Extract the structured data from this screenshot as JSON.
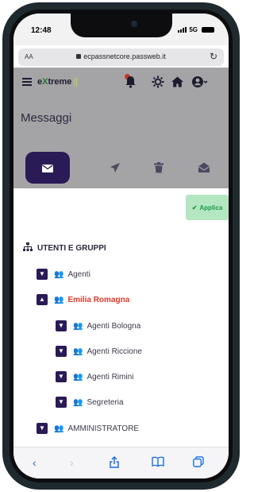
{
  "status": {
    "time": "12:48",
    "network": "5G"
  },
  "browser": {
    "text_size": "AA",
    "url": "ecpassnetcore.passweb.it",
    "reload_icon": "reload-icon"
  },
  "appbar": {
    "brand_prefix": "e",
    "brand_x": "X",
    "brand_rest": "treme",
    "brand_bar": "||",
    "icons": [
      "menu-icon",
      "bell-icon",
      "sun-icon",
      "home-icon",
      "user-icon"
    ]
  },
  "page": {
    "title": "Messaggi",
    "tabs": [
      {
        "icon": "envelope-icon",
        "active": true
      },
      {
        "icon": "send-icon",
        "active": false
      },
      {
        "icon": "trash-icon",
        "active": false
      },
      {
        "icon": "envelope-open-icon",
        "active": false
      }
    ]
  },
  "apply_label": "Applica",
  "section_title": "UTENTI E GRUPPI",
  "tree": [
    {
      "label": "Agenti",
      "expanded": false,
      "level": 0,
      "highlight": false
    },
    {
      "label": "Emilia Romagna",
      "expanded": true,
      "level": 0,
      "highlight": true
    },
    {
      "label": "Agenti Bologna",
      "expanded": false,
      "level": 1,
      "highlight": false
    },
    {
      "label": "Agenti Riccione",
      "expanded": false,
      "level": 1,
      "highlight": false
    },
    {
      "label": "Agenti Rimini",
      "expanded": false,
      "level": 1,
      "highlight": false
    },
    {
      "label": "Segreteria",
      "expanded": false,
      "level": 1,
      "highlight": false
    },
    {
      "label": "AMMINISTRATORE",
      "expanded": false,
      "level": 0,
      "highlight": false
    }
  ],
  "toolbar": {
    "icons": [
      "back-icon",
      "forward-icon",
      "share-icon",
      "bookmarks-icon",
      "tabs-icon"
    ]
  },
  "colors": {
    "accent": "#2a1a55",
    "group_red": "#e0392b",
    "apply_bg": "#b4e6c2",
    "apply_text": "#1e9a48"
  }
}
